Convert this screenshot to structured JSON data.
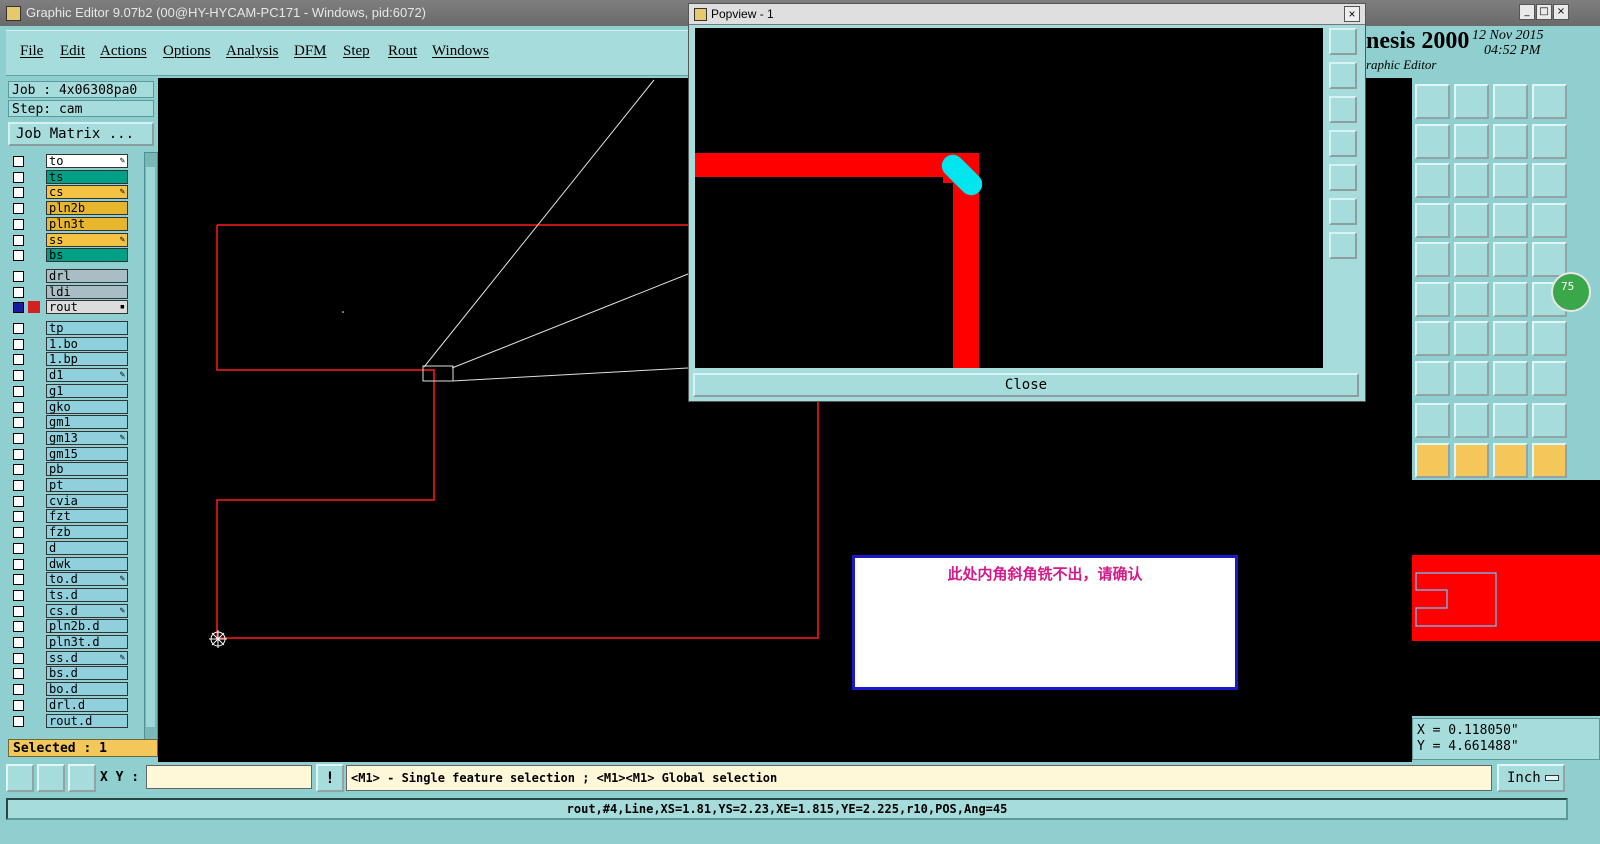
{
  "window": {
    "title": "Graphic Editor 9.07b2 (00@HY-HYCAM-PC171 - Windows, pid:6072)",
    "min_label": "_",
    "max_label": "□",
    "close_label": "×"
  },
  "menu": [
    "File",
    "Edit",
    "Actions",
    "Options",
    "Analysis",
    "DFM",
    "Step",
    "Rout",
    "Windows"
  ],
  "job": {
    "job_label": "Job : 4x06308pa0",
    "step_label": "Step: cam",
    "matrix_button": "Job Matrix ..."
  },
  "layers": [
    {
      "name": "to",
      "color": "#ffffff",
      "flag": "✎"
    },
    {
      "name": "ts",
      "color": "#00a087",
      "flag": ""
    },
    {
      "name": "cs",
      "color": "#f4c342",
      "flag": "✎"
    },
    {
      "name": "pln2b",
      "color": "#e8b62c",
      "flag": ""
    },
    {
      "name": "pln3t",
      "color": "#e8b62c",
      "flag": ""
    },
    {
      "name": "ss",
      "color": "#f4c342",
      "flag": "✎"
    },
    {
      "name": "bs",
      "color": "#00a087",
      "flag": ""
    },
    {
      "name": "drl",
      "color": "#a9bec4",
      "flag": ""
    },
    {
      "name": "ldi",
      "color": "#a9bec4",
      "flag": ""
    },
    {
      "name": "rout",
      "color": "#dcdcdc",
      "flag": "▪"
    },
    {
      "name": "tp",
      "color": "#8fd0dc",
      "flag": ""
    },
    {
      "name": "1.bo",
      "color": "#8fd0dc",
      "flag": ""
    },
    {
      "name": "1.bp",
      "color": "#8fd0dc",
      "flag": ""
    },
    {
      "name": "d1",
      "color": "#8fd0dc",
      "flag": "✎"
    },
    {
      "name": "g1",
      "color": "#8fd0dc",
      "flag": ""
    },
    {
      "name": "gko",
      "color": "#8fd0dc",
      "flag": ""
    },
    {
      "name": "gm1",
      "color": "#8fd0dc",
      "flag": ""
    },
    {
      "name": "gm13",
      "color": "#8fd0dc",
      "flag": "✎"
    },
    {
      "name": "gm15",
      "color": "#8fd0dc",
      "flag": ""
    },
    {
      "name": "pb",
      "color": "#8fd0dc",
      "flag": ""
    },
    {
      "name": "pt",
      "color": "#8fd0dc",
      "flag": ""
    },
    {
      "name": "cvia",
      "color": "#8fd0dc",
      "flag": ""
    },
    {
      "name": "fzt",
      "color": "#8fd0dc",
      "flag": ""
    },
    {
      "name": "fzb",
      "color": "#8fd0dc",
      "flag": ""
    },
    {
      "name": "d",
      "color": "#8fd0dc",
      "flag": ""
    },
    {
      "name": "dwk",
      "color": "#8fd0dc",
      "flag": ""
    },
    {
      "name": "to.d",
      "color": "#8fd0dc",
      "flag": "✎"
    },
    {
      "name": "ts.d",
      "color": "#8fd0dc",
      "flag": ""
    },
    {
      "name": "cs.d",
      "color": "#8fd0dc",
      "flag": "✎"
    },
    {
      "name": "pln2b.d",
      "color": "#8fd0dc",
      "flag": ""
    },
    {
      "name": "pln3t.d",
      "color": "#8fd0dc",
      "flag": ""
    },
    {
      "name": "ss.d",
      "color": "#8fd0dc",
      "flag": "✎"
    },
    {
      "name": "bs.d",
      "color": "#8fd0dc",
      "flag": ""
    },
    {
      "name": "bo.d",
      "color": "#8fd0dc",
      "flag": ""
    },
    {
      "name": "drl.d",
      "color": "#8fd0dc",
      "flag": ""
    },
    {
      "name": "rout.d",
      "color": "#8fd0dc",
      "flag": ""
    }
  ],
  "selected_label": "Selected : 1",
  "popview": {
    "title": "Popview - 1",
    "close_label": "Close",
    "close_x": "×"
  },
  "app_brand": {
    "name": "nesis 2000",
    "subtitle": "raphic Editor",
    "date": "12 Nov 2015",
    "time": "04:52 PM"
  },
  "badge": "75",
  "coords": {
    "x": "X =  0.118050\"",
    "y": "Y =  4.661488\""
  },
  "bottom": {
    "xy_label": "X Y :",
    "alert_label": "!",
    "message": "<M1> - Single feature selection ; <M1><M1> Global selection",
    "unit": "Inch"
  },
  "status": "rout,#4,Line,XS=1.81,YS=2.23,XE=1.815,YE=2.225,r10,POS,Ang=45",
  "note": "此处内角斜角铣不出，请确认"
}
